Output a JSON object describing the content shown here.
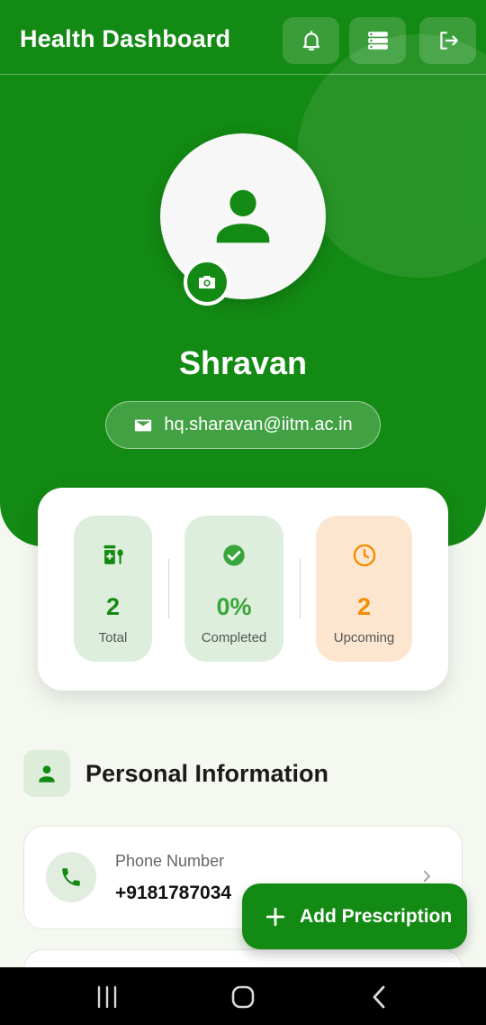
{
  "appbar": {
    "title": "Health Dashboard",
    "actions": [
      "bell-icon",
      "storage-icon",
      "logout-icon"
    ]
  },
  "profile": {
    "name": "Shravan",
    "email": "hq.sharavan@iitm.ac.in"
  },
  "stats": [
    {
      "value": "2",
      "label": "Total",
      "icon": "medication-icon",
      "color": "#138a13"
    },
    {
      "value": "0%",
      "label": "Completed",
      "icon": "check-circle-icon",
      "color": "#3aa53a"
    },
    {
      "value": "2",
      "label": "Upcoming",
      "icon": "clock-icon",
      "color": "#f28c00"
    }
  ],
  "section": {
    "title": "Personal Information"
  },
  "info_items": [
    {
      "label": "Phone Number",
      "value": "+9181787034",
      "icon": "phone-icon"
    }
  ],
  "fab": {
    "label": "Add Prescription"
  },
  "colors": {
    "primary": "#138a13",
    "accent_orange": "#f28c00",
    "background": "#f4f8f1"
  }
}
